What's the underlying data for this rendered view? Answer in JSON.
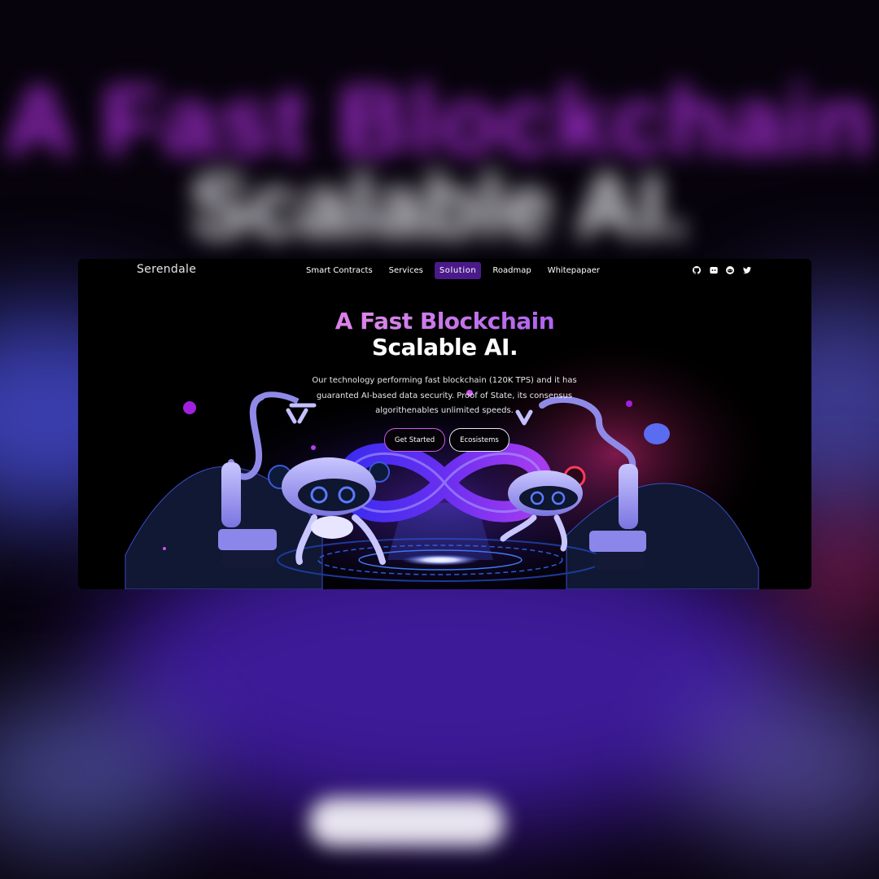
{
  "brand": {
    "name": "Serendale"
  },
  "nav": {
    "items": [
      {
        "label": "Smart Contracts"
      },
      {
        "label": "Services"
      },
      {
        "label": "Solution",
        "active": true
      },
      {
        "label": "Roadmap"
      },
      {
        "label": "Whitepapaer"
      }
    ]
  },
  "socials": [
    {
      "icon": "github-icon"
    },
    {
      "icon": "discord-icon"
    },
    {
      "icon": "reddit-icon"
    },
    {
      "icon": "twitter-icon"
    }
  ],
  "hero": {
    "title_line1": "A Fast Blockchain",
    "title_line2": "Scalable AI.",
    "description_line1": "Our technology performing fast blockchain (120K TPS) and it has",
    "description_line2": "guaranted AI-based data security. Proof of State, its consensus",
    "description_line3": "algorithenables unlimited speeds.",
    "primary_button": "Get Started",
    "secondary_button": "Ecosistems"
  },
  "colors": {
    "accent_purple": "#4a1a8a",
    "gradient_pink": "#e24ce0",
    "gradient_violet": "#8f4df1",
    "background": "#000000"
  }
}
